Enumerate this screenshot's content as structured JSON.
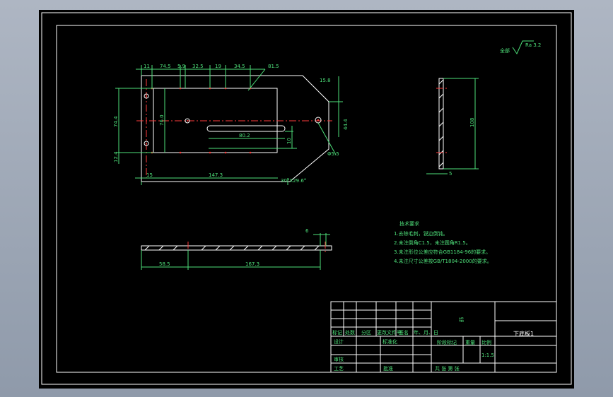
{
  "colors": {
    "background": "#000000",
    "frame": "#ffffff",
    "dimension": "#4ee07a",
    "centerline": "#ff3b3b",
    "outer_bg": "#9aa3b2"
  },
  "roughness": {
    "label": "全部",
    "value": "Ra 3.2"
  },
  "plan_view": {
    "dims_top": [
      "11",
      "74.5",
      "5.9",
      "32.5",
      "19",
      "34.5",
      "81.5"
    ],
    "dim_left_height": "74.4",
    "dim_inner_height": "76.0",
    "dim_left_small": "12.4",
    "dim_slot_length": "80.2",
    "dim_slot_width": "10",
    "dim_bottom_left": "15",
    "dim_bottom_length": "147.3",
    "dim_right_height": "44.4",
    "dim_top_right": "15.8",
    "dim_right_dia": "Φ5.5",
    "chamfer_note": "30°X29.6°"
  },
  "side_view": {
    "height": "108",
    "thickness": "5"
  },
  "section_view": {
    "thickness": "6",
    "dim_left": "58.5",
    "dim_total": "167.3"
  },
  "notes": {
    "title": "技术要求",
    "items": [
      "1.去除毛刺，锐边倒钝。",
      "2.未注倒角C1.5，未注圆角R1.5。",
      "3.未注形位公差应符合GB1184-96的要求。",
      "4.未注尺寸公差按GB/T1804-2000的要求。"
    ]
  },
  "title_block": {
    "material": "铝",
    "part_name": "下底板1",
    "header_cells": [
      "标记",
      "处数",
      "分区",
      "更改文件号",
      "签名",
      "年、月、日"
    ],
    "design_label": "设计",
    "standard_label": "标准化",
    "review_label": "审核",
    "process_label": "工艺",
    "approve_label": "批准",
    "stage_label": "阶段标记",
    "weight_label": "重量",
    "scale_label": "比例",
    "scale_value": "1:1.5",
    "sheets_label": "共   张   第   张"
  }
}
